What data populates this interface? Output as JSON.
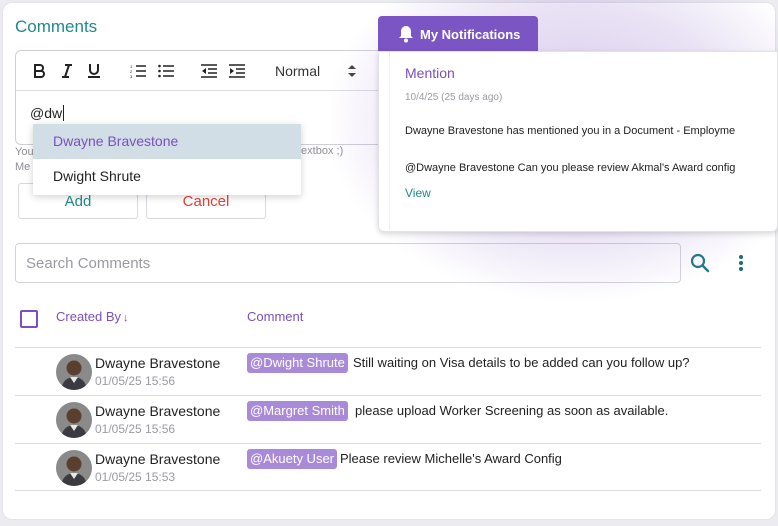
{
  "comments": {
    "title": "Comments",
    "editor": {
      "format_select": "Normal",
      "text": "@dw",
      "hint_line1": "You",
      "hint_line2": "Me",
      "hint_right": "is textbox ;)"
    },
    "mention_options": [
      "Dwayne Bravestone",
      "Dwight Shrute"
    ],
    "add_label": "Add",
    "cancel_label": "Cancel",
    "search_placeholder": "Search Comments",
    "table": {
      "col_created_by": "Created By",
      "sort_indicator": "↓",
      "col_comment": "Comment",
      "rows": [
        {
          "name": "Dwayne Bravestone",
          "date": "01/05/25 15:56",
          "mention": "@Dwight Shrute",
          "text": "Still waiting on Visa details to be added can you follow up?"
        },
        {
          "name": "Dwayne Bravestone",
          "date": "01/05/25 15:56",
          "mention": "@Margret Smith",
          "text": "please upload Worker Screening as soon as available."
        },
        {
          "name": "Dwayne Bravestone",
          "date": "01/05/25 15:53",
          "mention": "@Akuety User",
          "text": "Please review Michelle's Award Config"
        }
      ]
    }
  },
  "notifications": {
    "tab_label": "My Notifications",
    "title": "Mention",
    "date": "10/4/25 (25 days ago)",
    "line1": "Dwayne Bravestone has mentioned you in a Document - Employme",
    "line2": "@Dwayne Bravestone Can you please review Akmal's Award config",
    "view_label": "View"
  },
  "colors": {
    "accent_purple": "#7a4fbf",
    "accent_teal": "#1f8a8a",
    "danger": "#e0423a",
    "mention_tag": "#a98ad8"
  },
  "icons": [
    "bold-icon",
    "italic-icon",
    "underline-icon",
    "ordered-list-icon",
    "bullet-list-icon",
    "outdent-icon",
    "indent-icon",
    "search-icon",
    "more-vertical-icon",
    "bell-icon"
  ]
}
